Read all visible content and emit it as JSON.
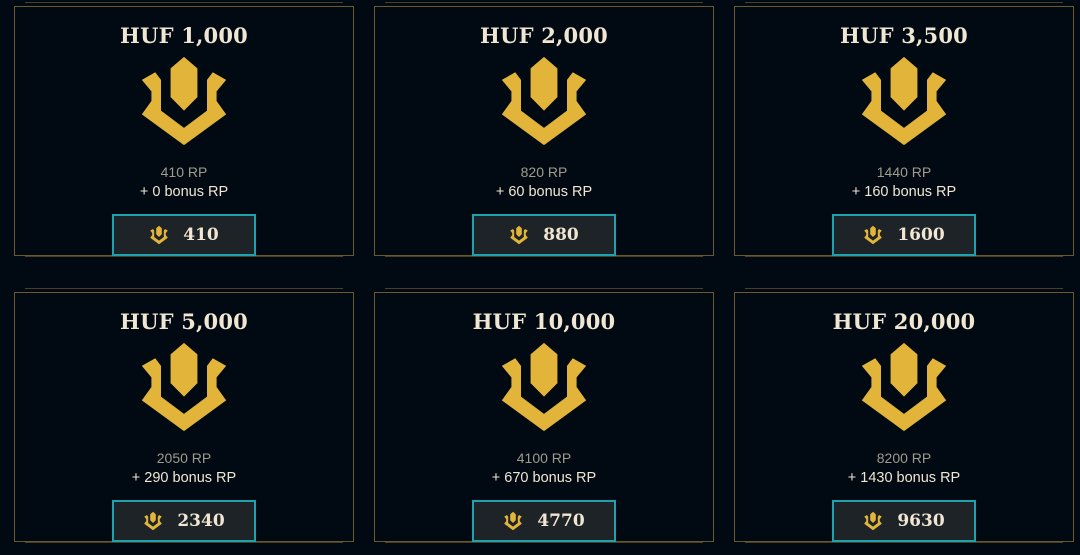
{
  "packages": [
    {
      "price": "HUF 1,000",
      "base_rp": "410 RP",
      "bonus_rp": "+ 0 bonus RP",
      "total": "410"
    },
    {
      "price": "HUF 2,000",
      "base_rp": "820 RP",
      "bonus_rp": "+ 60 bonus RP",
      "total": "880"
    },
    {
      "price": "HUF 3,500",
      "base_rp": "1440 RP",
      "bonus_rp": "+ 160 bonus RP",
      "total": "1600"
    },
    {
      "price": "HUF 5,000",
      "base_rp": "2050 RP",
      "bonus_rp": "+ 290 bonus RP",
      "total": "2340"
    },
    {
      "price": "HUF 10,000",
      "base_rp": "4100 RP",
      "bonus_rp": "+ 670 bonus RP",
      "total": "4770"
    },
    {
      "price": "HUF 20,000",
      "base_rp": "8200 RP",
      "bonus_rp": "+ 1430 bonus RP",
      "total": "9630"
    }
  ],
  "icons": {
    "emblem": "riot-points-icon",
    "button_icon": "riot-points-icon"
  },
  "colors": {
    "gold": "#e2b53a",
    "button_border": "#1ea2b0",
    "card_border": "#6b5a2e",
    "background": "#010a13"
  }
}
